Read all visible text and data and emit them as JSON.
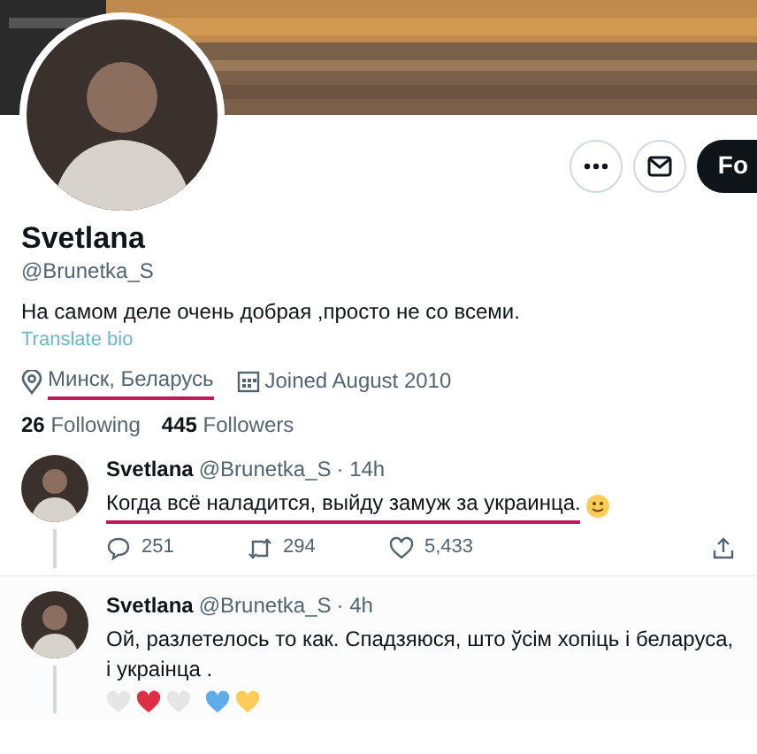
{
  "profile": {
    "name": "Svetlana",
    "handle": "@Brunetka_S",
    "bio": "На самом деле очень добрая ,просто не со всеми.",
    "translate_link": "Translate bio",
    "location": {
      "text": "Минск, Беларусь",
      "underlined": true
    },
    "joined": "Joined August 2010",
    "stats": [
      {
        "count": "26",
        "label": "Following"
      },
      {
        "count": "445",
        "label": "Followers"
      }
    ],
    "actions": [
      {
        "kind": "more"
      },
      {
        "kind": "message"
      },
      {
        "kind": "follow",
        "label": "Fo"
      }
    ]
  },
  "tweets": [
    {
      "name": "Svetlana",
      "handle": "@Brunetka_S",
      "time": "· 14h",
      "text": "Когда всё наладится, выйду замуж за украинца.",
      "underlined": true,
      "smiley": true,
      "thread_line": true,
      "counts": [
        {
          "kind": "reply",
          "value": "251"
        },
        {
          "kind": "retweet",
          "value": "294"
        },
        {
          "kind": "like",
          "value": "5,433"
        },
        {
          "kind": "share"
        }
      ]
    },
    {
      "name": "Svetlana",
      "handle": "@Brunetka_S",
      "time": "· 4h",
      "text": "Ой, разлетелось то как. Спадзяюся, што ўсім хопіць і беларуса, і украінца .",
      "thread_line": true,
      "hearts": [
        {
          "color": "#e6e6e6"
        },
        {
          "color": "#dd2e44"
        },
        {
          "color": "#e6e6e6"
        },
        {
          "color": "#5dadec"
        },
        {
          "color": "#fdcb58"
        }
      ]
    }
  ]
}
